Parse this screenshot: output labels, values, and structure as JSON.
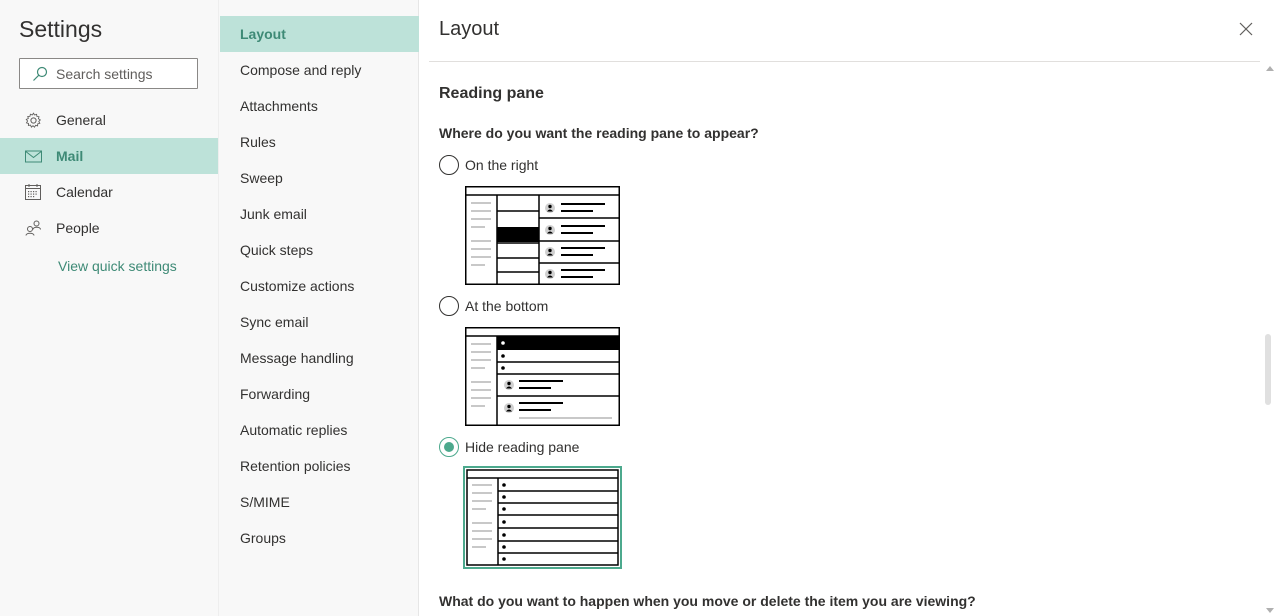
{
  "app": {
    "title": "Settings",
    "search_placeholder": "Search settings",
    "accent_color": "#3e8a76",
    "selected_bg": "#bde2d9"
  },
  "nav": {
    "items": [
      {
        "label": "General",
        "icon": "gear-icon",
        "active": false
      },
      {
        "label": "Mail",
        "icon": "mail-icon",
        "active": true
      },
      {
        "label": "Calendar",
        "icon": "calendar-icon",
        "active": false
      },
      {
        "label": "People",
        "icon": "people-icon",
        "active": false
      }
    ],
    "quick_settings_link": "View quick settings"
  },
  "subnav": {
    "items": [
      {
        "label": "Layout",
        "active": true
      },
      {
        "label": "Compose and reply",
        "active": false
      },
      {
        "label": "Attachments",
        "active": false
      },
      {
        "label": "Rules",
        "active": false
      },
      {
        "label": "Sweep",
        "active": false
      },
      {
        "label": "Junk email",
        "active": false
      },
      {
        "label": "Quick steps",
        "active": false
      },
      {
        "label": "Customize actions",
        "active": false
      },
      {
        "label": "Sync email",
        "active": false
      },
      {
        "label": "Message handling",
        "active": false
      },
      {
        "label": "Forwarding",
        "active": false
      },
      {
        "label": "Automatic replies",
        "active": false
      },
      {
        "label": "Retention policies",
        "active": false
      },
      {
        "label": "S/MIME",
        "active": false
      },
      {
        "label": "Groups",
        "active": false
      }
    ]
  },
  "content": {
    "title": "Layout",
    "section_title": "Reading pane",
    "question_1": "Where do you want the reading pane to appear?",
    "options": [
      {
        "label": "On the right",
        "checked": false,
        "preview": "reading-pane-right"
      },
      {
        "label": "At the bottom",
        "checked": false,
        "preview": "reading-pane-bottom"
      },
      {
        "label": "Hide reading pane",
        "checked": true,
        "preview": "reading-pane-hidden"
      }
    ],
    "question_2": "What do you want to happen when you move or delete the item you are viewing?"
  }
}
